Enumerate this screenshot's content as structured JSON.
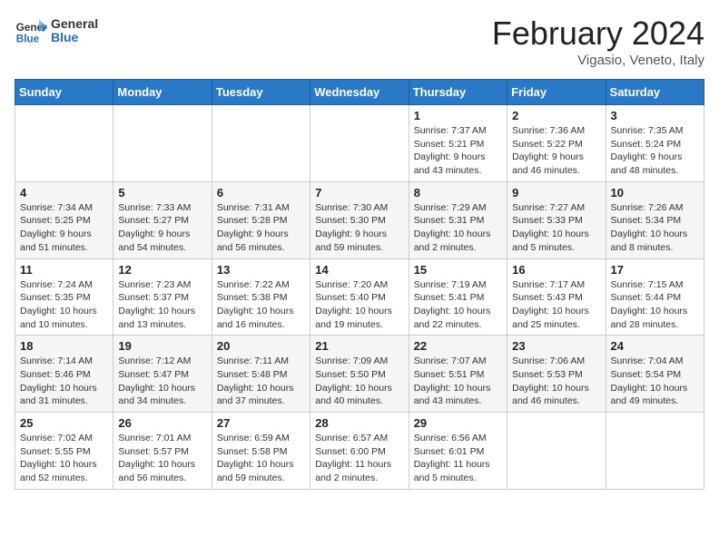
{
  "logo": {
    "general": "General",
    "blue": "Blue"
  },
  "header": {
    "title": "February 2024",
    "subtitle": "Vigasio, Veneto, Italy"
  },
  "weekdays": [
    "Sunday",
    "Monday",
    "Tuesday",
    "Wednesday",
    "Thursday",
    "Friday",
    "Saturday"
  ],
  "weeks": [
    [
      {
        "day": "",
        "info": ""
      },
      {
        "day": "",
        "info": ""
      },
      {
        "day": "",
        "info": ""
      },
      {
        "day": "",
        "info": ""
      },
      {
        "day": "1",
        "info": "Sunrise: 7:37 AM\nSunset: 5:21 PM\nDaylight: 9 hours\nand 43 minutes."
      },
      {
        "day": "2",
        "info": "Sunrise: 7:36 AM\nSunset: 5:22 PM\nDaylight: 9 hours\nand 46 minutes."
      },
      {
        "day": "3",
        "info": "Sunrise: 7:35 AM\nSunset: 5:24 PM\nDaylight: 9 hours\nand 48 minutes."
      }
    ],
    [
      {
        "day": "4",
        "info": "Sunrise: 7:34 AM\nSunset: 5:25 PM\nDaylight: 9 hours\nand 51 minutes."
      },
      {
        "day": "5",
        "info": "Sunrise: 7:33 AM\nSunset: 5:27 PM\nDaylight: 9 hours\nand 54 minutes."
      },
      {
        "day": "6",
        "info": "Sunrise: 7:31 AM\nSunset: 5:28 PM\nDaylight: 9 hours\nand 56 minutes."
      },
      {
        "day": "7",
        "info": "Sunrise: 7:30 AM\nSunset: 5:30 PM\nDaylight: 9 hours\nand 59 minutes."
      },
      {
        "day": "8",
        "info": "Sunrise: 7:29 AM\nSunset: 5:31 PM\nDaylight: 10 hours\nand 2 minutes."
      },
      {
        "day": "9",
        "info": "Sunrise: 7:27 AM\nSunset: 5:33 PM\nDaylight: 10 hours\nand 5 minutes."
      },
      {
        "day": "10",
        "info": "Sunrise: 7:26 AM\nSunset: 5:34 PM\nDaylight: 10 hours\nand 8 minutes."
      }
    ],
    [
      {
        "day": "11",
        "info": "Sunrise: 7:24 AM\nSunset: 5:35 PM\nDaylight: 10 hours\nand 10 minutes."
      },
      {
        "day": "12",
        "info": "Sunrise: 7:23 AM\nSunset: 5:37 PM\nDaylight: 10 hours\nand 13 minutes."
      },
      {
        "day": "13",
        "info": "Sunrise: 7:22 AM\nSunset: 5:38 PM\nDaylight: 10 hours\nand 16 minutes."
      },
      {
        "day": "14",
        "info": "Sunrise: 7:20 AM\nSunset: 5:40 PM\nDaylight: 10 hours\nand 19 minutes."
      },
      {
        "day": "15",
        "info": "Sunrise: 7:19 AM\nSunset: 5:41 PM\nDaylight: 10 hours\nand 22 minutes."
      },
      {
        "day": "16",
        "info": "Sunrise: 7:17 AM\nSunset: 5:43 PM\nDaylight: 10 hours\nand 25 minutes."
      },
      {
        "day": "17",
        "info": "Sunrise: 7:15 AM\nSunset: 5:44 PM\nDaylight: 10 hours\nand 28 minutes."
      }
    ],
    [
      {
        "day": "18",
        "info": "Sunrise: 7:14 AM\nSunset: 5:46 PM\nDaylight: 10 hours\nand 31 minutes."
      },
      {
        "day": "19",
        "info": "Sunrise: 7:12 AM\nSunset: 5:47 PM\nDaylight: 10 hours\nand 34 minutes."
      },
      {
        "day": "20",
        "info": "Sunrise: 7:11 AM\nSunset: 5:48 PM\nDaylight: 10 hours\nand 37 minutes."
      },
      {
        "day": "21",
        "info": "Sunrise: 7:09 AM\nSunset: 5:50 PM\nDaylight: 10 hours\nand 40 minutes."
      },
      {
        "day": "22",
        "info": "Sunrise: 7:07 AM\nSunset: 5:51 PM\nDaylight: 10 hours\nand 43 minutes."
      },
      {
        "day": "23",
        "info": "Sunrise: 7:06 AM\nSunset: 5:53 PM\nDaylight: 10 hours\nand 46 minutes."
      },
      {
        "day": "24",
        "info": "Sunrise: 7:04 AM\nSunset: 5:54 PM\nDaylight: 10 hours\nand 49 minutes."
      }
    ],
    [
      {
        "day": "25",
        "info": "Sunrise: 7:02 AM\nSunset: 5:55 PM\nDaylight: 10 hours\nand 52 minutes."
      },
      {
        "day": "26",
        "info": "Sunrise: 7:01 AM\nSunset: 5:57 PM\nDaylight: 10 hours\nand 56 minutes."
      },
      {
        "day": "27",
        "info": "Sunrise: 6:59 AM\nSunset: 5:58 PM\nDaylight: 10 hours\nand 59 minutes."
      },
      {
        "day": "28",
        "info": "Sunrise: 6:57 AM\nSunset: 6:00 PM\nDaylight: 11 hours\nand 2 minutes."
      },
      {
        "day": "29",
        "info": "Sunrise: 6:56 AM\nSunset: 6:01 PM\nDaylight: 11 hours\nand 5 minutes."
      },
      {
        "day": "",
        "info": ""
      },
      {
        "day": "",
        "info": ""
      }
    ]
  ]
}
